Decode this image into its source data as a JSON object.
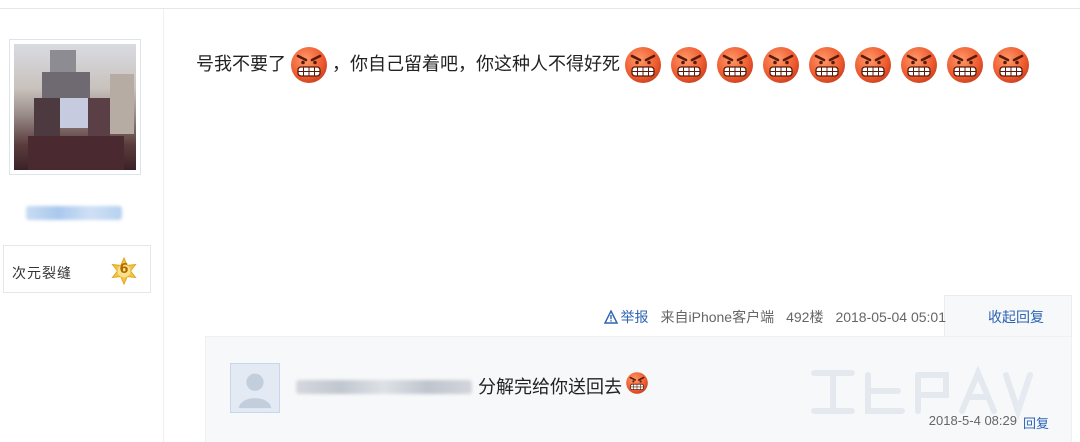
{
  "user": {
    "level_name": "次元裂缝",
    "level_number": "6"
  },
  "post": {
    "text_part1": "号我不要了",
    "text_part2": "，你自己留着吧，你这种人不得好死",
    "emoji_name": "angry-grin-emoji"
  },
  "tail": {
    "report_label": "举报",
    "source": "来自iPhone客户端",
    "floor": "492楼",
    "time": "2018-05-04 05:01",
    "collapse_reply_label": "收起回复"
  },
  "sub_reply": {
    "text": "分解完给你送回去",
    "time": "2018-5-4 08:29",
    "reply_label": "回复"
  },
  "colors": {
    "link": "#2d64b3",
    "emoji_fill": "#f0663a",
    "level_badge": "#f5c542"
  }
}
